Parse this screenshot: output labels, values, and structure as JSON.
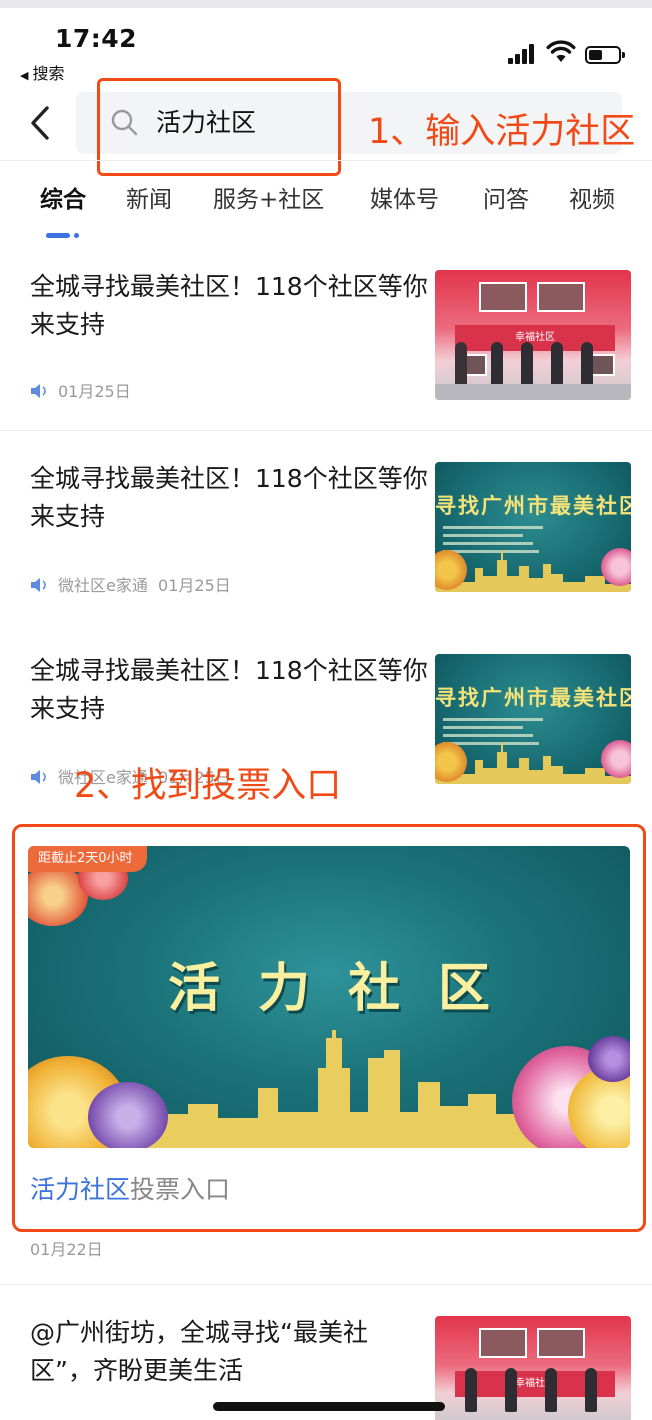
{
  "status_bar": {
    "time": "17:42",
    "back_app": "搜索"
  },
  "search": {
    "query": "活力社区"
  },
  "annotations": {
    "step1": "1、输入活力社区",
    "step2": "2、找到投票入口"
  },
  "tabs": [
    {
      "label": "综合",
      "active": true
    },
    {
      "label": "新闻"
    },
    {
      "label": "服务+社区"
    },
    {
      "label": "媒体号"
    },
    {
      "label": "问答"
    },
    {
      "label": "视频"
    }
  ],
  "news": [
    {
      "title": "全城寻找最美社区！118个社区等你来支持",
      "source": "",
      "date": "01月25日",
      "thumb": "community-event"
    },
    {
      "title": "全城寻找最美社区！118个社区等你来支持",
      "source": "微社区e家通",
      "date": "01月25日",
      "thumb": "teal-poster"
    },
    {
      "title": "全城寻找最美社区！118个社区等你来支持",
      "source": "微社区e家通",
      "date": "01月25日",
      "thumb": "teal-poster"
    }
  ],
  "thumb_text": {
    "event_banner": "幸福社区",
    "poster_title": "寻找广州市最美社区"
  },
  "feature": {
    "countdown": "距截止2天0小时",
    "banner_title": "活力社区",
    "caption_highlight": "活力社区",
    "caption_rest": "投票入口",
    "date": "01月22日"
  },
  "last_news": {
    "title": "@广州街坊，全城寻找“最美社区”，齐盼更美生活",
    "thumb": "community-event",
    "banner": "幸福社区"
  },
  "colors": {
    "accent_blue": "#3b71e0",
    "annotation_red": "#f24a16",
    "poster_teal": "#1a7278",
    "poster_gold": "#fbf0a0"
  }
}
